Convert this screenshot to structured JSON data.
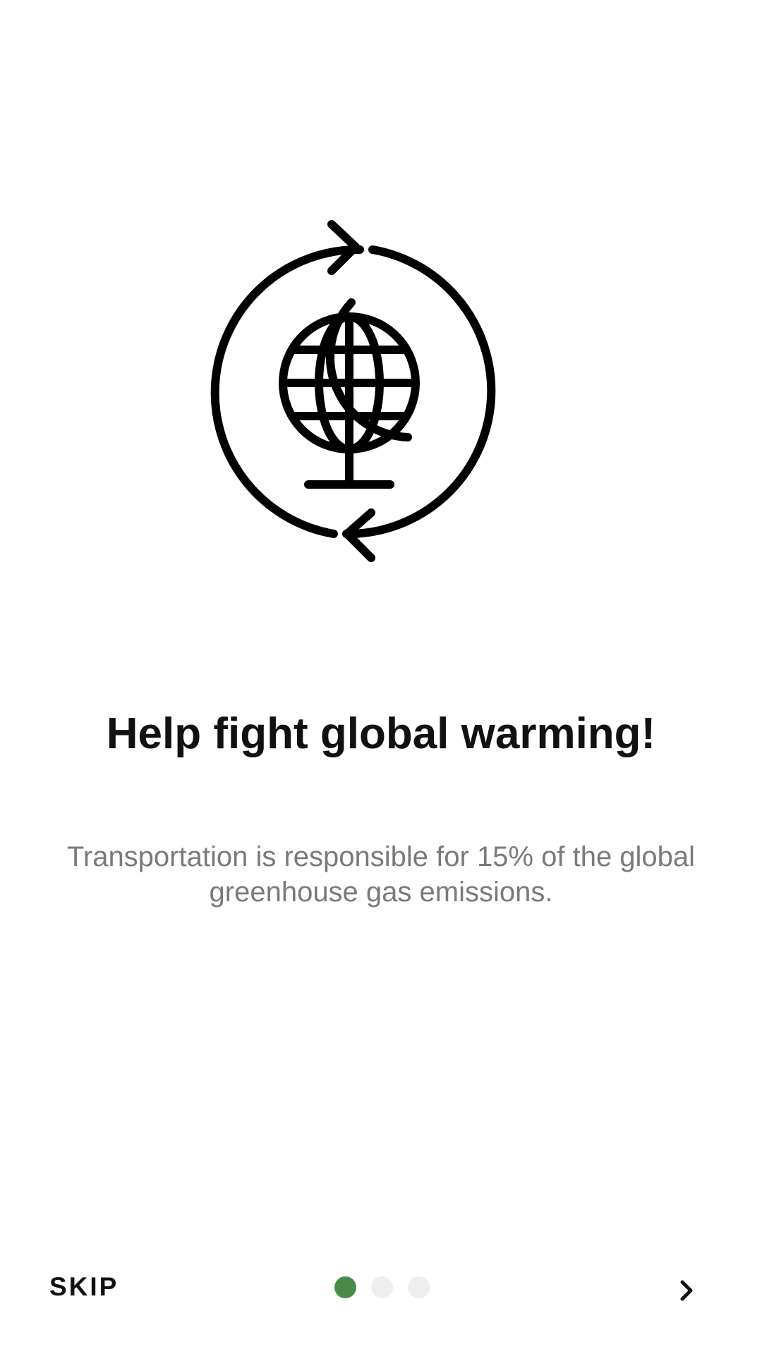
{
  "onboarding": {
    "illustration_icon": "globe-rotation-arrows-icon",
    "title": "Help fight global warming!",
    "description": "Transportation is responsible for 15% of the global greenhouse gas emissions."
  },
  "navigation": {
    "skip_label": "SKIP",
    "next_icon": "chevron-right-icon",
    "page_count": 3,
    "current_page": 1
  },
  "colors": {
    "active_dot": "#4a8b4a",
    "inactive_dot": "#eeeeee",
    "title": "#111111",
    "description": "#7a7a7a"
  }
}
